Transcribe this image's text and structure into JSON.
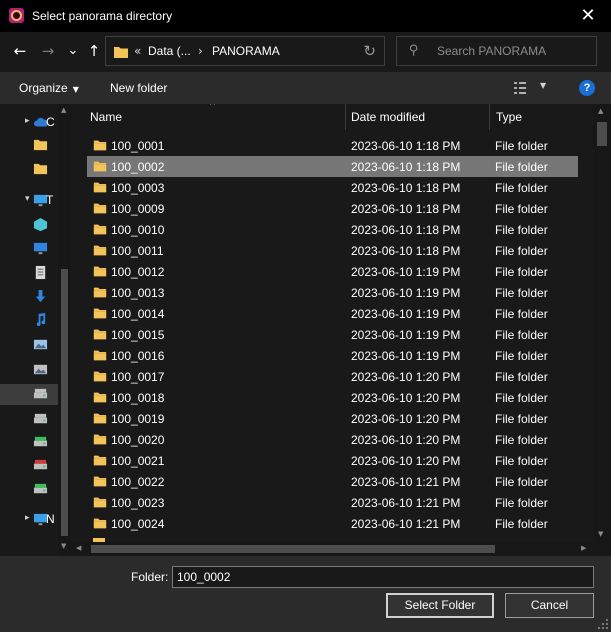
{
  "window": {
    "title": "Select panorama directory",
    "close_glyph": "✕",
    "app_icon": "app-icon"
  },
  "nav": {
    "back_glyph": "←",
    "forward_glyph": "→",
    "recent_glyph": "⌄",
    "up_glyph": "↑",
    "address": {
      "overflow_glyph": "«",
      "crumbs": [
        "Data (...",
        "PANORAMA"
      ],
      "separator_glyph": "›",
      "refresh_glyph": "↻"
    },
    "search": {
      "placeholder": "Search PANORAMA",
      "icon": "search-icon"
    }
  },
  "toolbar": {
    "organize_label": "Organize",
    "new_folder_label": "New folder",
    "caret_glyph": "▼",
    "help_glyph": "?"
  },
  "navpane": {
    "items": [
      {
        "label": "C",
        "icon": "onedrive-icon",
        "color": "#2e7bd6"
      },
      {
        "label": "",
        "icon": "folder-icon",
        "color": "#f2c45a"
      },
      {
        "label": "",
        "icon": "folder-icon",
        "color": "#f2c45a"
      },
      {
        "label": "T",
        "icon": "this-pc-icon",
        "color": "#3aa0e8"
      },
      {
        "label": "",
        "icon": "3d-objects-icon",
        "color": "#4fc3d9"
      },
      {
        "label": "",
        "icon": "desktop-icon",
        "color": "#2e86de"
      },
      {
        "label": "",
        "icon": "documents-icon",
        "color": "#d9d9d9"
      },
      {
        "label": "",
        "icon": "downloads-icon",
        "color": "#2e86de"
      },
      {
        "label": "",
        "icon": "music-icon",
        "color": "#2e86de"
      },
      {
        "label": "",
        "icon": "pictures-icon",
        "color": "#9ec3e6"
      },
      {
        "label": "",
        "icon": "videos-icon",
        "color": "#c0c0c0"
      },
      {
        "label": "",
        "icon": "local-disk-icon",
        "color": "#c0c0c0"
      },
      {
        "label": "",
        "icon": "drive-icon",
        "color": "#c0c0c0"
      },
      {
        "label": "",
        "icon": "network-drive-icon",
        "color": "#3cbf5a"
      },
      {
        "label": "",
        "icon": "network-drive-disconnected-icon",
        "color": "#d23a3a"
      },
      {
        "label": "",
        "icon": "network-drive-icon",
        "color": "#3cbf5a"
      },
      {
        "label": "N",
        "icon": "network-icon",
        "color": "#3aa0e8"
      }
    ]
  },
  "list": {
    "columns": [
      "Name",
      "Date modified",
      "Type"
    ],
    "sort_glyph": "^",
    "selected_index": 1,
    "rows": [
      {
        "name": "100_0001",
        "date": "2023-06-10 1:18 PM",
        "type": "File folder"
      },
      {
        "name": "100_0002",
        "date": "2023-06-10 1:18 PM",
        "type": "File folder"
      },
      {
        "name": "100_0003",
        "date": "2023-06-10 1:18 PM",
        "type": "File folder"
      },
      {
        "name": "100_0009",
        "date": "2023-06-10 1:18 PM",
        "type": "File folder"
      },
      {
        "name": "100_0010",
        "date": "2023-06-10 1:18 PM",
        "type": "File folder"
      },
      {
        "name": "100_0011",
        "date": "2023-06-10 1:18 PM",
        "type": "File folder"
      },
      {
        "name": "100_0012",
        "date": "2023-06-10 1:19 PM",
        "type": "File folder"
      },
      {
        "name": "100_0013",
        "date": "2023-06-10 1:19 PM",
        "type": "File folder"
      },
      {
        "name": "100_0014",
        "date": "2023-06-10 1:19 PM",
        "type": "File folder"
      },
      {
        "name": "100_0015",
        "date": "2023-06-10 1:19 PM",
        "type": "File folder"
      },
      {
        "name": "100_0016",
        "date": "2023-06-10 1:19 PM",
        "type": "File folder"
      },
      {
        "name": "100_0017",
        "date": "2023-06-10 1:20 PM",
        "type": "File folder"
      },
      {
        "name": "100_0018",
        "date": "2023-06-10 1:20 PM",
        "type": "File folder"
      },
      {
        "name": "100_0019",
        "date": "2023-06-10 1:20 PM",
        "type": "File folder"
      },
      {
        "name": "100_0020",
        "date": "2023-06-10 1:20 PM",
        "type": "File folder"
      },
      {
        "name": "100_0021",
        "date": "2023-06-10 1:20 PM",
        "type": "File folder"
      },
      {
        "name": "100_0022",
        "date": "2023-06-10 1:21 PM",
        "type": "File folder"
      },
      {
        "name": "100_0023",
        "date": "2023-06-10 1:21 PM",
        "type": "File folder"
      },
      {
        "name": "100_0024",
        "date": "2023-06-10 1:21 PM",
        "type": "File folder"
      }
    ]
  },
  "footer": {
    "folder_label": "Folder:",
    "folder_value": "100_0002",
    "select_button": "Select Folder",
    "cancel_button": "Cancel"
  },
  "colors": {
    "folder": "#f2c45a",
    "folder_tab": "#d9a73e",
    "selection": "#777777",
    "accent": "#1a6fd6"
  }
}
